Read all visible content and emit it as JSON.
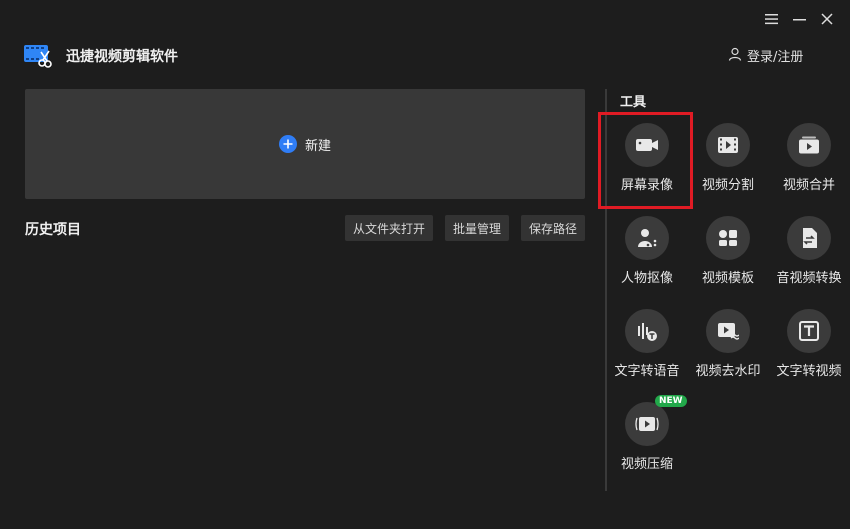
{
  "app": {
    "title": "迅捷视频剪辑软件"
  },
  "header": {
    "login_label": "登录/注册"
  },
  "new_panel": {
    "label": "新建"
  },
  "history": {
    "title": "历史项目",
    "buttons": [
      "从文件夹打开",
      "批量管理",
      "保存路径"
    ]
  },
  "tools": {
    "title": "工具",
    "items": [
      {
        "label": "屏幕录像",
        "icon": "camera-icon"
      },
      {
        "label": "视频分割",
        "icon": "film-split-icon"
      },
      {
        "label": "视频合并",
        "icon": "video-merge-icon"
      },
      {
        "label": "人物抠像",
        "icon": "portrait-cutout-icon"
      },
      {
        "label": "视频模板",
        "icon": "template-icon"
      },
      {
        "label": "音视频转换",
        "icon": "convert-icon"
      },
      {
        "label": "文字转语音",
        "icon": "text-to-speech-icon"
      },
      {
        "label": "视频去水印",
        "icon": "remove-watermark-icon"
      },
      {
        "label": "文字转视频",
        "icon": "text-to-video-icon"
      },
      {
        "label": "视频压缩",
        "icon": "compress-icon",
        "badge": "NEW"
      }
    ]
  },
  "colors": {
    "background": "#1d1d1d",
    "panel": "#383838",
    "accent": "#2f7df6",
    "highlight": "#e01b24",
    "badge": "#22a84a"
  }
}
